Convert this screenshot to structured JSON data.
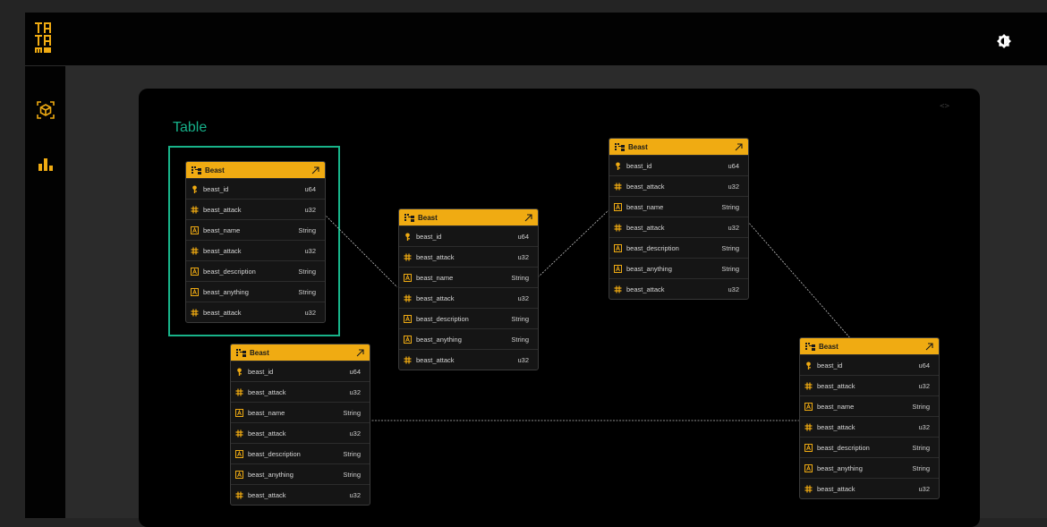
{
  "app": {
    "logo_text": "TATA MSD"
  },
  "header": {
    "theme_toggle_icon": "brightness-icon"
  },
  "sidebar": {
    "items": [
      {
        "name": "schema-icon"
      },
      {
        "name": "bar-chart-icon"
      }
    ]
  },
  "canvas": {
    "title": "Table",
    "code_icon": "<>",
    "colors": {
      "accent": "#16b089",
      "header": "#f0ab12",
      "background": "#000000"
    }
  },
  "entities": [
    {
      "title": "Beast",
      "fields": [
        {
          "icon": "key",
          "name": "beast_id",
          "type": "u64"
        },
        {
          "icon": "hash",
          "name": "beast_attack",
          "type": "u32"
        },
        {
          "icon": "text",
          "name": "beast_name",
          "type": "String"
        },
        {
          "icon": "hash",
          "name": "beast_attack",
          "type": "u32"
        },
        {
          "icon": "text",
          "name": "beast_description",
          "type": "String"
        },
        {
          "icon": "text",
          "name": "beast_anything",
          "type": "String"
        },
        {
          "icon": "hash",
          "name": "beast_attack",
          "type": "u32"
        }
      ]
    },
    {
      "title": "Beast",
      "fields": [
        {
          "icon": "key",
          "name": "beast_id",
          "type": "u64"
        },
        {
          "icon": "hash",
          "name": "beast_attack",
          "type": "u32"
        },
        {
          "icon": "text",
          "name": "beast_name",
          "type": "String"
        },
        {
          "icon": "hash",
          "name": "beast_attack",
          "type": "u32"
        },
        {
          "icon": "text",
          "name": "beast_description",
          "type": "String"
        },
        {
          "icon": "text",
          "name": "beast_anything",
          "type": "String"
        },
        {
          "icon": "hash",
          "name": "beast_attack",
          "type": "u32"
        }
      ]
    },
    {
      "title": "Beast",
      "fields": [
        {
          "icon": "key",
          "name": "beast_id",
          "type": "u64"
        },
        {
          "icon": "hash",
          "name": "beast_attack",
          "type": "u32"
        },
        {
          "icon": "text",
          "name": "beast_name",
          "type": "String"
        },
        {
          "icon": "hash",
          "name": "beast_attack",
          "type": "u32"
        },
        {
          "icon": "text",
          "name": "beast_description",
          "type": "String"
        },
        {
          "icon": "text",
          "name": "beast_anything",
          "type": "String"
        },
        {
          "icon": "hash",
          "name": "beast_attack",
          "type": "u32"
        }
      ]
    },
    {
      "title": "Beast",
      "fields": [
        {
          "icon": "key",
          "name": "beast_id",
          "type": "u64"
        },
        {
          "icon": "hash",
          "name": "beast_attack",
          "type": "u32"
        },
        {
          "icon": "text",
          "name": "beast_name",
          "type": "String"
        },
        {
          "icon": "hash",
          "name": "beast_attack",
          "type": "u32"
        },
        {
          "icon": "text",
          "name": "beast_description",
          "type": "String"
        },
        {
          "icon": "text",
          "name": "beast_anything",
          "type": "String"
        },
        {
          "icon": "hash",
          "name": "beast_attack",
          "type": "u32"
        }
      ]
    },
    {
      "title": "Beast",
      "fields": [
        {
          "icon": "key",
          "name": "beast_id",
          "type": "u64"
        },
        {
          "icon": "hash",
          "name": "beast_attack",
          "type": "u32"
        },
        {
          "icon": "text",
          "name": "beast_name",
          "type": "String"
        },
        {
          "icon": "hash",
          "name": "beast_attack",
          "type": "u32"
        },
        {
          "icon": "text",
          "name": "beast_description",
          "type": "String"
        },
        {
          "icon": "text",
          "name": "beast_anything",
          "type": "String"
        },
        {
          "icon": "hash",
          "name": "beast_attack",
          "type": "u32"
        }
      ]
    }
  ]
}
